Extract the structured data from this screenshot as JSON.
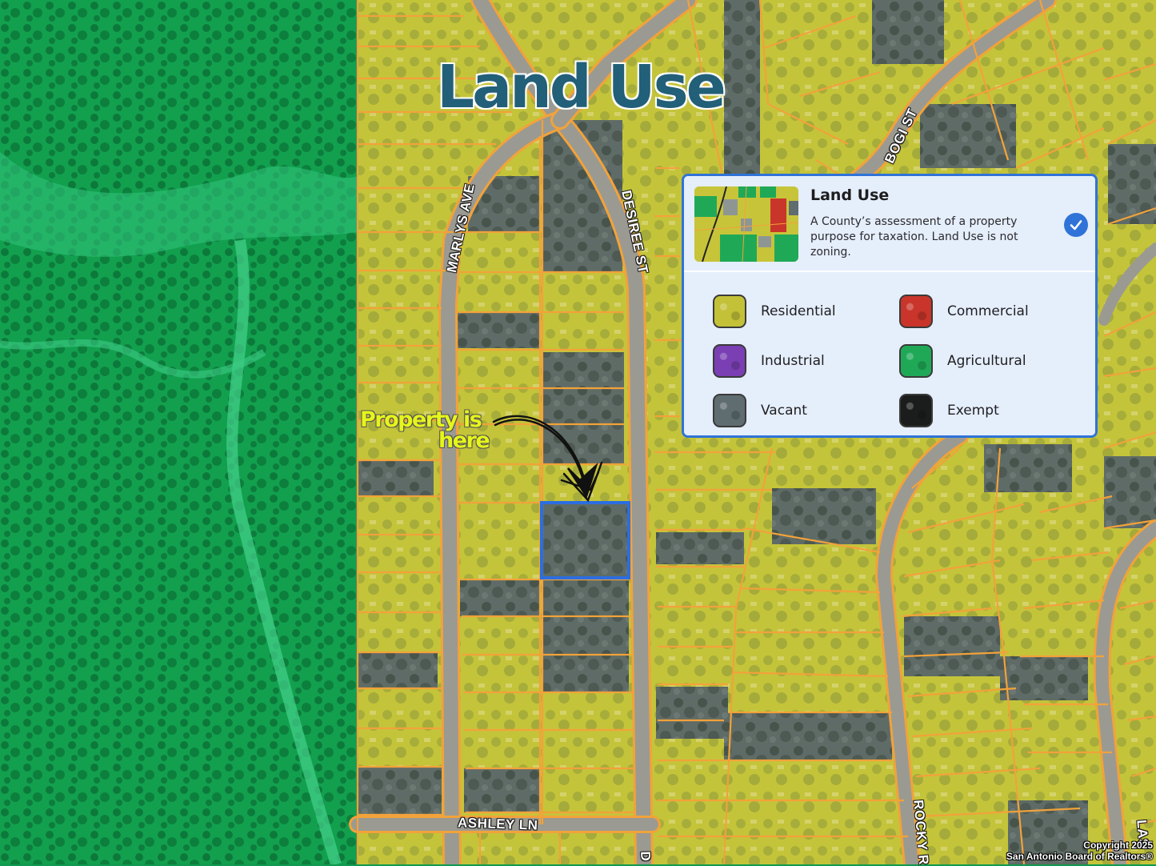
{
  "title": "Land Use",
  "callout": {
    "line1": "Property is",
    "line2": "here"
  },
  "streets": {
    "marlys": "MARLYS AVE",
    "desiree": "DESIREE ST",
    "bogi": "BOGI ST",
    "ashley": "ASHLEY LN",
    "rocky": "ROCKY R",
    "las": "LAS",
    "d": "D"
  },
  "panel": {
    "title": "Land Use",
    "description": "A County’s assessment of a property purpose for taxation. Land Use is not zoning.",
    "checked": true,
    "legend": [
      {
        "label": "Residential",
        "color": "#c3c137"
      },
      {
        "label": "Commercial",
        "color": "#c9352a"
      },
      {
        "label": "Industrial",
        "color": "#7a3fb3"
      },
      {
        "label": "Agricultural",
        "color": "#1fa957"
      },
      {
        "label": "Vacant",
        "color": "#5f6c70"
      },
      {
        "label": "Exempt",
        "color": "#1b1d1c"
      }
    ]
  },
  "copyright": {
    "line1": "Copyright 2025",
    "line2": "San Antonio Board of Realtors®"
  },
  "colors": {
    "agricultural": "#0f9a50",
    "residential": "#c4c43a",
    "vacant": "#5d6a66",
    "parcel_line": "#f2a23a",
    "road": "#9a9a92",
    "selected_parcel": "#2b6ee0",
    "title": "#225f78",
    "callout": "#e6f51a"
  }
}
